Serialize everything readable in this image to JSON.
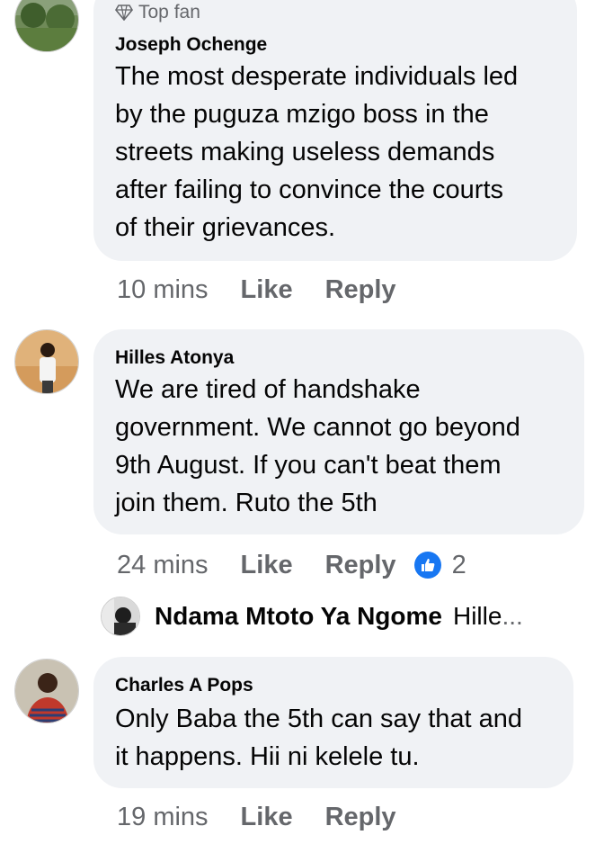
{
  "comments": [
    {
      "badge": "Top fan",
      "author": "Joseph Ochenge",
      "text": "The most desperate individuals led\nby the puguza mzigo boss in the\nstreets making useless demands\nafter failing to convince the courts\nof their grievances.",
      "time": "10 mins",
      "like_label": "Like",
      "reply_label": "Reply"
    },
    {
      "author": "Hilles Atonya",
      "text": "We are tired of handshake\ngovernment.  We cannot go beyond\n9th August. If you can't beat them\njoin them.  Ruto the 5th",
      "time": "24 mins",
      "like_label": "Like",
      "reply_label": "Reply",
      "reaction_count": "2",
      "reaction_icon": "like-thumb-icon",
      "reaction_color": "#1877f2"
    },
    {
      "author": "Charles A Pops",
      "text": "Only Baba the 5th can say that and\nit happens. Hii ni kelele tu.",
      "time": "19 mins",
      "like_label": "Like",
      "reply_label": "Reply"
    }
  ],
  "reply_preview": {
    "author": "Ndama Mtoto Ya Ngome",
    "text": "Hille",
    "ellipsis": "..."
  },
  "colors": {
    "bubble": "#f0f2f5",
    "secondary_text": "#65676b",
    "primary_text": "#050505",
    "accent": "#1877f2"
  }
}
